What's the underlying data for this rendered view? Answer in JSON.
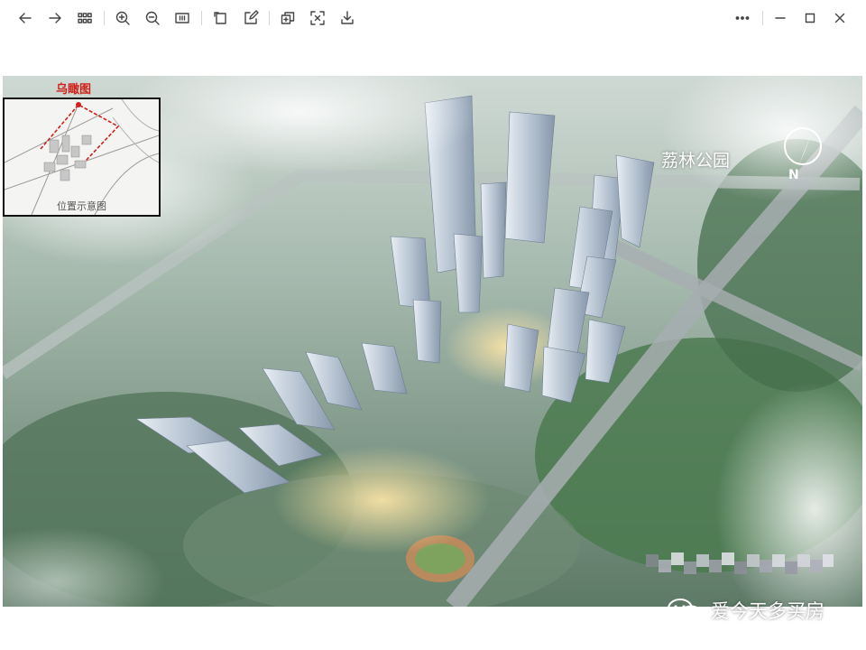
{
  "toolbar": {
    "icons": [
      "arrow-left-icon",
      "arrow-right-icon",
      "grid-icon",
      "zoom-in-icon",
      "zoom-out-icon",
      "fit-width-icon",
      "rotate-icon",
      "edit-icon",
      "copy-icon",
      "ocr-icon",
      "download-icon",
      "more-icon",
      "minimize-icon",
      "maximize-icon",
      "close-icon"
    ]
  },
  "image": {
    "inset_title": "乌瞰图",
    "inset_caption": "位置示意图",
    "park_label": "荔林公园",
    "watermark_text": "爱今天多买房",
    "colors": {
      "inset_red": "#d0201a",
      "sky_haze": "#c9d6d0",
      "vegetation": "#3f6a44"
    }
  }
}
